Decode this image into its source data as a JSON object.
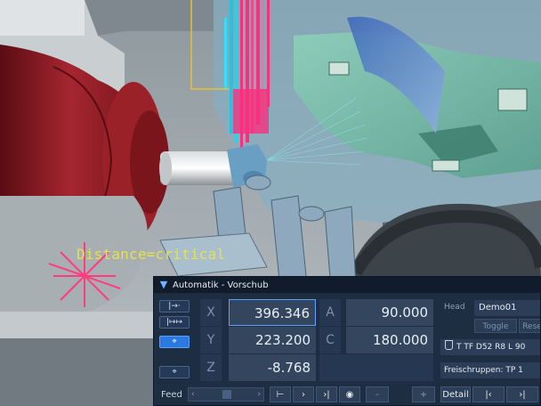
{
  "annotation": {
    "text": "Distance=critical"
  },
  "panel": {
    "title": "Automatik - Vorschub",
    "mode_buttons": [
      {
        "icon": "linear-move-icon",
        "glyph": "|→·"
      },
      {
        "icon": "rapid-move-icon",
        "glyph": "|↦↦"
      },
      {
        "icon": "crosshair-icon",
        "glyph": "⌖",
        "active": true
      },
      {
        "icon": "target-icon",
        "glyph": "⌖"
      }
    ],
    "axes": [
      {
        "label": "X",
        "value": "396.346"
      },
      {
        "label": "Y",
        "value": "223.200"
      },
      {
        "label": "Z",
        "value": "-8.768"
      }
    ],
    "rot_axes": [
      {
        "label": "A",
        "value": "90.000"
      },
      {
        "label": "C",
        "value": "180.000"
      }
    ],
    "head": {
      "label": "Head",
      "value": "Demo01"
    },
    "toggle_label": "Toggle",
    "reset_label": "Rese",
    "tool": "T TF D52 R8 L 90",
    "freischruppen": "Freischruppen: TP 1",
    "feed_label": "Feed",
    "controls": {
      "step_back": "⊢",
      "next": "›",
      "next_end": "›|",
      "record": "◉",
      "minus": "-",
      "plus": "+",
      "detail": "Detail",
      "prev_block": "|‹",
      "next_block": "›|"
    },
    "feed_fraction": 0.45
  },
  "colors": {
    "accent": "#2a79e0",
    "panel_bg": "#1d2d42",
    "annotation": "#e8e14a",
    "chuck_red": "#8e1d24"
  }
}
